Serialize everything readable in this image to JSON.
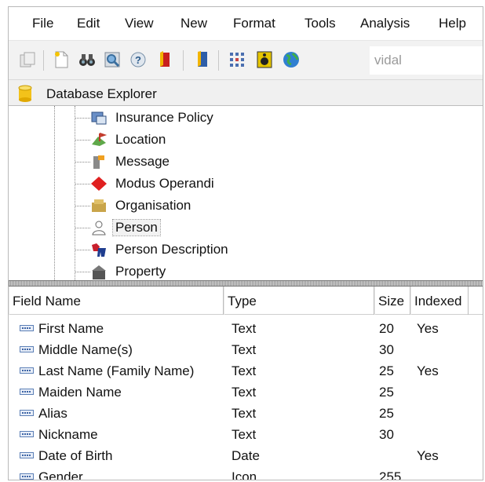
{
  "menu": {
    "items": [
      {
        "label": "File"
      },
      {
        "label": "Edit"
      },
      {
        "label": "View"
      },
      {
        "label": "New"
      },
      {
        "label": "Format"
      },
      {
        "label": "Tools"
      },
      {
        "label": "Analysis"
      },
      {
        "label": "Help"
      }
    ]
  },
  "toolbar": {
    "search_value": "vidal"
  },
  "explorer": {
    "title": "Database Explorer"
  },
  "tree": {
    "items": [
      {
        "label": "Insurance Policy"
      },
      {
        "label": "Location"
      },
      {
        "label": "Message"
      },
      {
        "label": "Modus Operandi"
      },
      {
        "label": "Organisation"
      },
      {
        "label": "Person",
        "selected": true
      },
      {
        "label": "Person Description"
      },
      {
        "label": "Property"
      }
    ]
  },
  "table": {
    "columns": [
      "Field Name",
      "Type",
      "Size",
      "Indexed"
    ],
    "rows": [
      {
        "name": "First Name",
        "type": "Text",
        "size": "20",
        "indexed": "Yes"
      },
      {
        "name": "Middle Name(s)",
        "type": "Text",
        "size": "30",
        "indexed": ""
      },
      {
        "name": "Last Name (Family Name)",
        "type": "Text",
        "size": "25",
        "indexed": "Yes"
      },
      {
        "name": "Maiden Name",
        "type": "Text",
        "size": "25",
        "indexed": ""
      },
      {
        "name": "Alias",
        "type": "Text",
        "size": "25",
        "indexed": ""
      },
      {
        "name": "Nickname",
        "type": "Text",
        "size": "30",
        "indexed": ""
      },
      {
        "name": "Date of Birth",
        "type": "Date",
        "size": "",
        "indexed": "Yes"
      },
      {
        "name": "Gender",
        "type": "Icon",
        "size": "255",
        "indexed": ""
      }
    ]
  },
  "colors": {
    "arrow": "#2a96d6",
    "selection": "#f2f2f2"
  }
}
